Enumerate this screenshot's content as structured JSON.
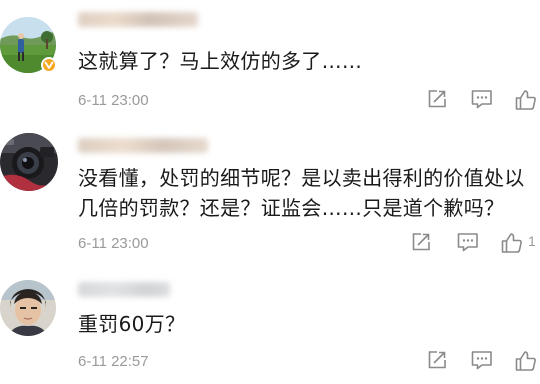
{
  "comments": [
    {
      "text": "这就算了？马上效仿的多了……",
      "time": "6-11 23:00",
      "verified": true,
      "like_count": ""
    },
    {
      "text": "没看懂，处罚的细节呢？是以卖出得利的价值处以几倍的罚款？还是？证监会……只是道个歉吗？",
      "time": "6-11 23:00",
      "verified": false,
      "like_count": "1"
    },
    {
      "text": "重罚60万？",
      "time": "6-11 22:57",
      "verified": false,
      "like_count": ""
    }
  ],
  "icons": {
    "share": "share-icon",
    "reply": "comment-icon",
    "like": "thumbs-up-icon"
  },
  "colors": {
    "text": "#1a1a1a",
    "meta": "#9a9a9a",
    "icon": "#8a8a8a",
    "verified_badge": "#f5a623"
  }
}
